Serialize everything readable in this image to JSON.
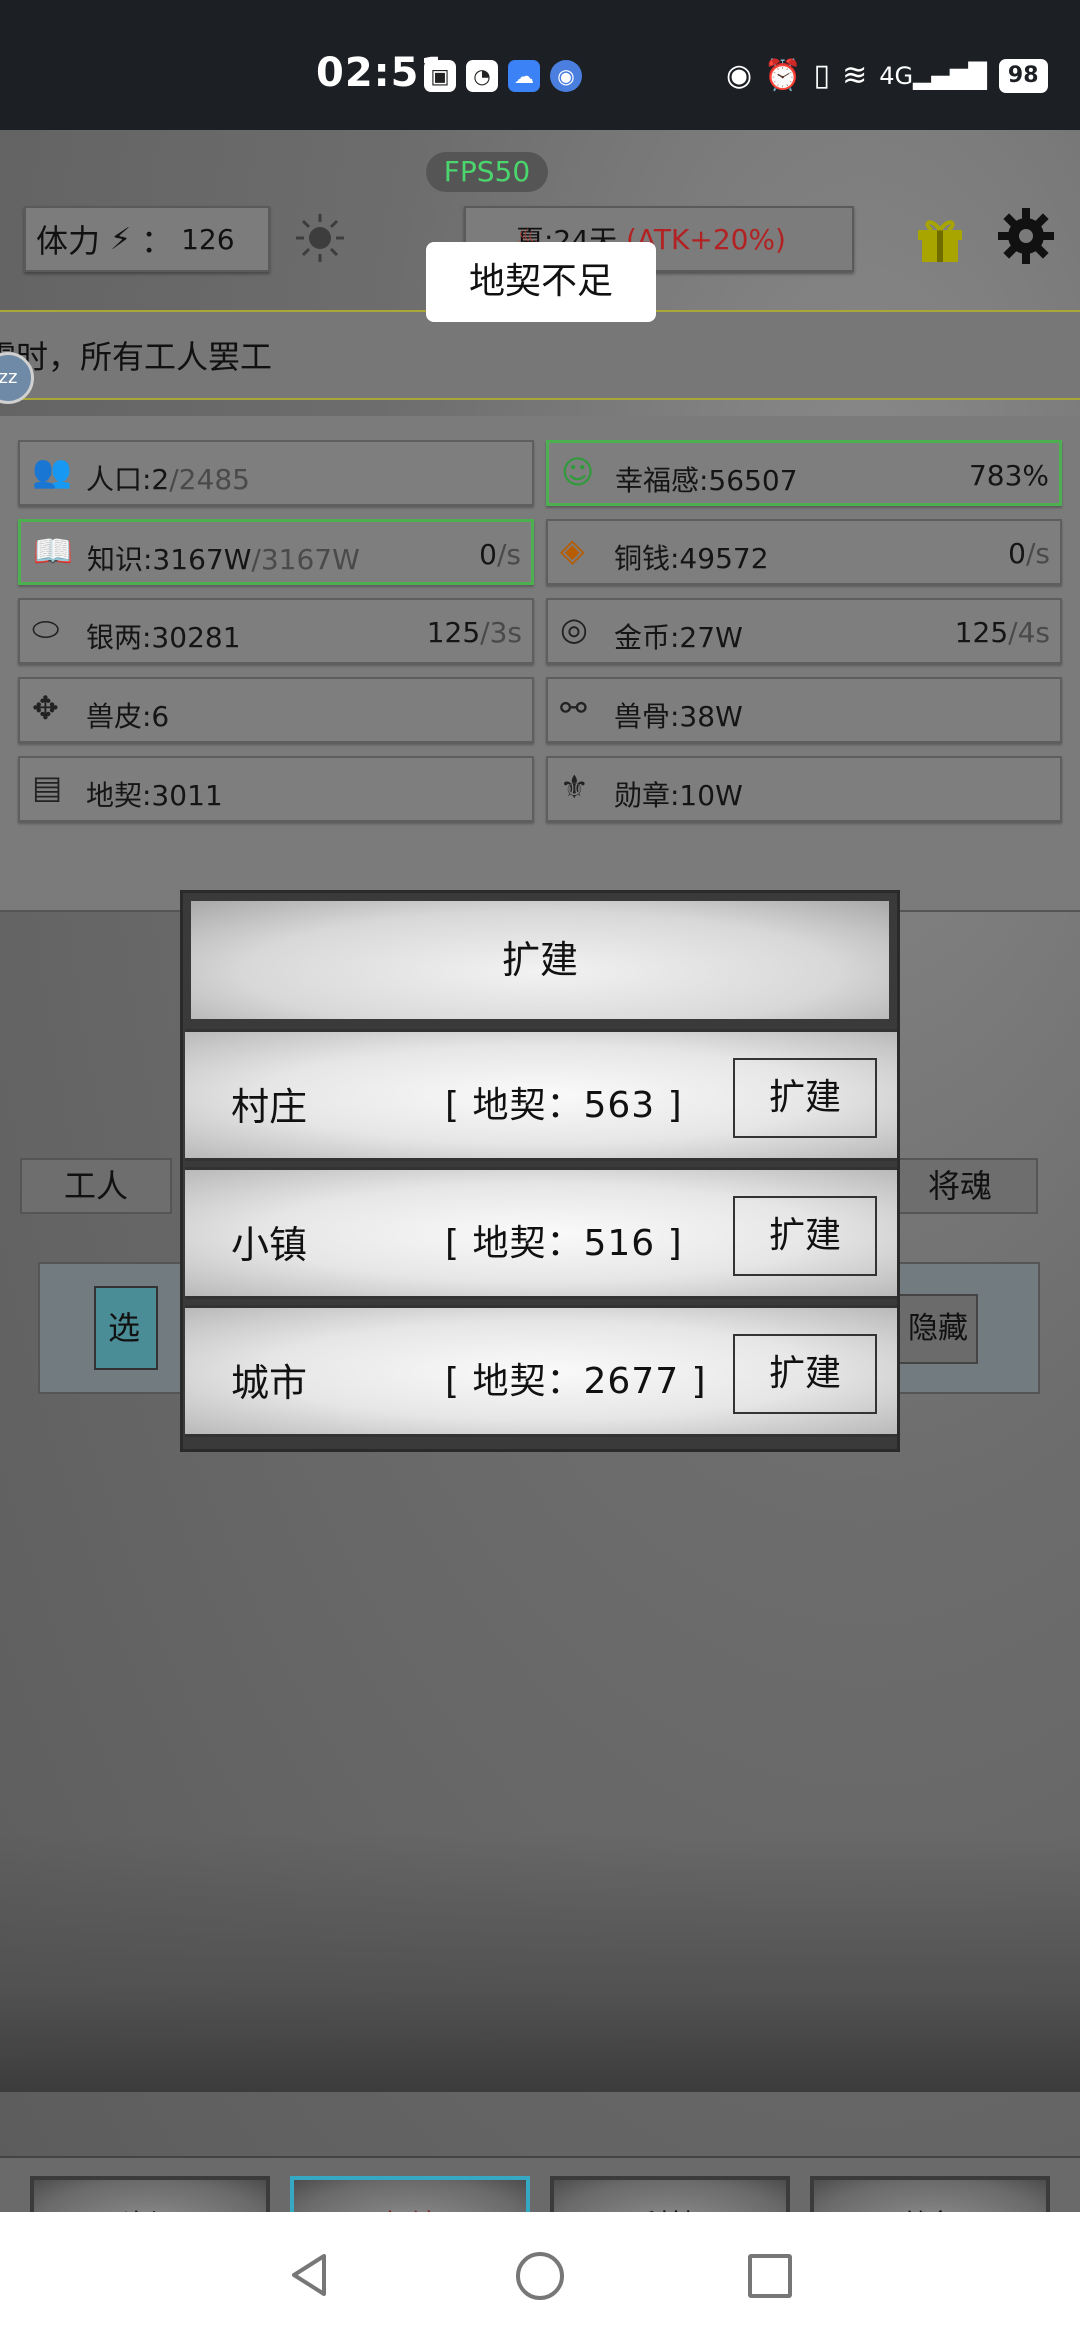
{
  "status_bar": {
    "time": "02:51",
    "notification_icons": [
      "huawei-icon",
      "wechat-icon",
      "cloud-icon",
      "browser-icon"
    ],
    "battery": "98",
    "network": "4G"
  },
  "top": {
    "fps": "FPS50",
    "stamina_label": "体力",
    "stamina_separator": "：",
    "stamina_value": "126",
    "season_text": "夏:24天",
    "season_bonus": "(ATK+20%)",
    "toast": "地契不足",
    "ticker": "零时，所有工人罢工",
    "sleep_badge": "zz"
  },
  "resources": [
    {
      "icon": "people-icon",
      "label": "人口:2",
      "cap": "/2485",
      "rate": "",
      "rate_unit": "",
      "highlight": false
    },
    {
      "icon": "smile-icon",
      "label": "幸福感:56507",
      "cap": "",
      "rate": "783%",
      "rate_unit": "",
      "highlight": true
    },
    {
      "icon": "book-icon",
      "label": "知识:3167W",
      "cap": "/3167W",
      "rate": "0",
      "rate_unit": "/s",
      "highlight": true
    },
    {
      "icon": "copper-coin-icon",
      "label": "铜钱:49572",
      "cap": "",
      "rate": "0",
      "rate_unit": "/s",
      "highlight": false
    },
    {
      "icon": "silver-ingot-icon",
      "label": "银两:30281",
      "cap": "",
      "rate": "125",
      "rate_unit": "/3s",
      "highlight": false
    },
    {
      "icon": "gold-coin-icon",
      "label": "金币:27W",
      "cap": "",
      "rate": "125",
      "rate_unit": "/4s",
      "highlight": false
    },
    {
      "icon": "beast-hide-icon",
      "label": "兽皮:6",
      "cap": "",
      "rate": "",
      "rate_unit": "",
      "highlight": false
    },
    {
      "icon": "bone-icon",
      "label": "兽骨:38W",
      "cap": "",
      "rate": "",
      "rate_unit": "",
      "highlight": false
    },
    {
      "icon": "deed-icon",
      "label": "地契:3011",
      "cap": "",
      "rate": "",
      "rate_unit": "",
      "highlight": false
    },
    {
      "icon": "medal-icon",
      "label": "勋章:10W",
      "cap": "",
      "rate": "",
      "rate_unit": "",
      "highlight": false
    }
  ],
  "background_tabs": {
    "worker": "工人",
    "soul": "将魂",
    "select": "选",
    "hide": "隐藏"
  },
  "dialog": {
    "title": "扩建",
    "rows": [
      {
        "name": "村庄",
        "cost": "[ 地契：563 ]",
        "button": "扩建"
      },
      {
        "name": "小镇",
        "cost": "[ 地契：516 ]",
        "button": "扩建"
      },
      {
        "name": "城市",
        "cost": "[ 地契：2677 ]",
        "button": "扩建"
      }
    ]
  },
  "bottom_nav": [
    {
      "label": "资源",
      "active": false
    },
    {
      "label": "领地",
      "active": true
    },
    {
      "label": "科技",
      "active": false
    },
    {
      "label": "战争",
      "active": false
    }
  ],
  "colors": {
    "fps_green": "#4ad66d",
    "highlight_green": "#4caf50",
    "active_tab_border": "#35a9c4",
    "atk_red": "#b22222"
  }
}
